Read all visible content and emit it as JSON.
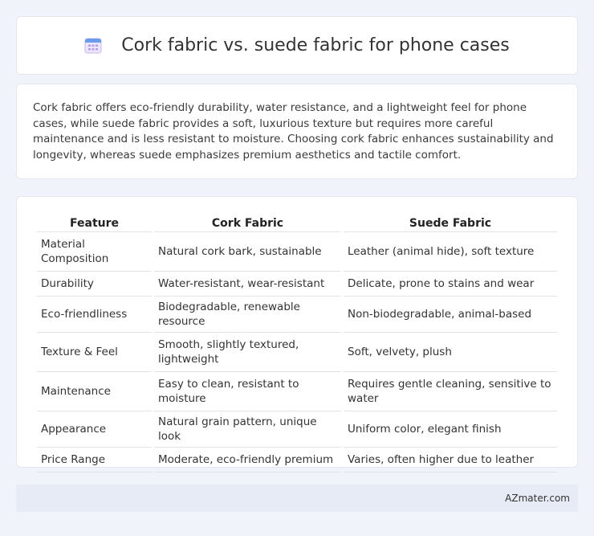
{
  "header": {
    "title": "Cork fabric vs. suede fabric for phone cases",
    "icon": "calendar-icon"
  },
  "summary": {
    "text": "Cork fabric offers eco-friendly durability, water resistance, and a lightweight feel for phone cases, while suede fabric provides a soft, luxurious texture but requires more careful maintenance and is less resistant to moisture. Choosing cork fabric enhances sustainability and longevity, whereas suede emphasizes premium aesthetics and tactile comfort."
  },
  "table": {
    "headers": [
      "Feature",
      "Cork Fabric",
      "Suede Fabric"
    ],
    "rows": [
      [
        "Material Composition",
        "Natural cork bark, sustainable",
        "Leather (animal hide), soft texture"
      ],
      [
        "Durability",
        "Water-resistant, wear-resistant",
        "Delicate, prone to stains and wear"
      ],
      [
        "Eco-friendliness",
        "Biodegradable, renewable resource",
        "Non-biodegradable, animal-based"
      ],
      [
        "Texture & Feel",
        "Smooth, slightly textured, lightweight",
        "Soft, velvety, plush"
      ],
      [
        "Maintenance",
        "Easy to clean, resistant to moisture",
        "Requires gentle cleaning, sensitive to water"
      ],
      [
        "Appearance",
        "Natural grain pattern, unique look",
        "Uniform color, elegant finish"
      ],
      [
        "Price Range",
        "Moderate, eco-friendly premium",
        "Varies, often higher due to leather"
      ]
    ]
  },
  "footer": {
    "text": "AZmater.com"
  },
  "colors": {
    "background": "#f0f3f9",
    "card": "#ffffff",
    "footer_bar": "#e6ebf5",
    "icon_blue": "#5b8fe6",
    "icon_purple": "#b99ce8"
  }
}
